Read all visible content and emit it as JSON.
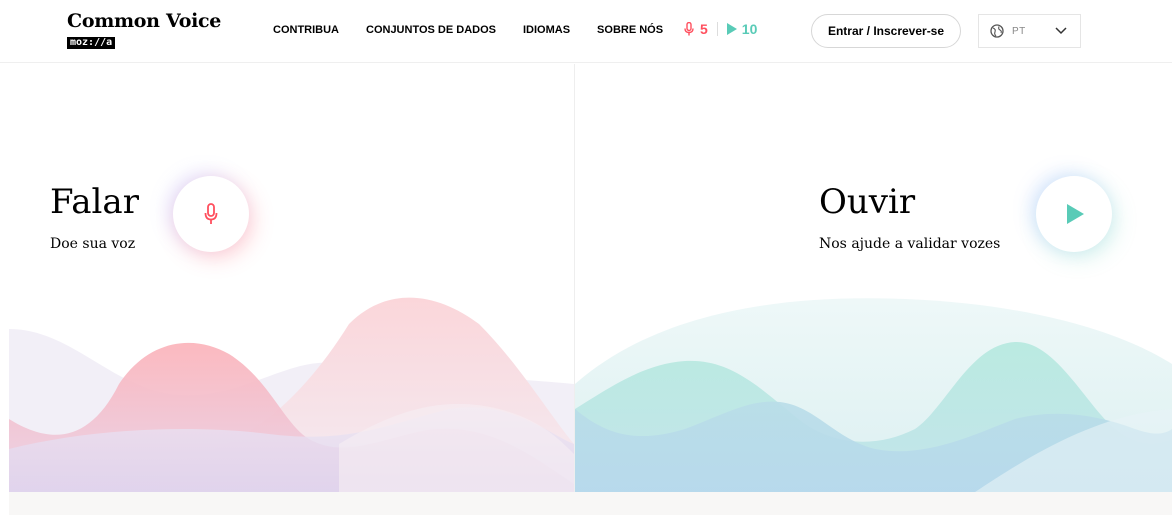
{
  "header": {
    "logo_title": "Common Voice",
    "logo_brand": "moz://a",
    "nav": [
      "CONTRIBUA",
      "CONJUNTOS DE DADOS",
      "IDIOMAS",
      "SOBRE NÓS"
    ],
    "speak_count": "5",
    "listen_count": "10",
    "login_label": "Entrar / Inscrever-se",
    "language_code": "PT"
  },
  "speak": {
    "title": "Falar",
    "subtitle": "Doe sua voz",
    "icon": "microphone-icon",
    "color": "#ff4f5e"
  },
  "listen": {
    "title": "Ouvir",
    "subtitle": "Nos ajude a validar vozes",
    "icon": "play-icon",
    "color": "#59cbb7"
  }
}
